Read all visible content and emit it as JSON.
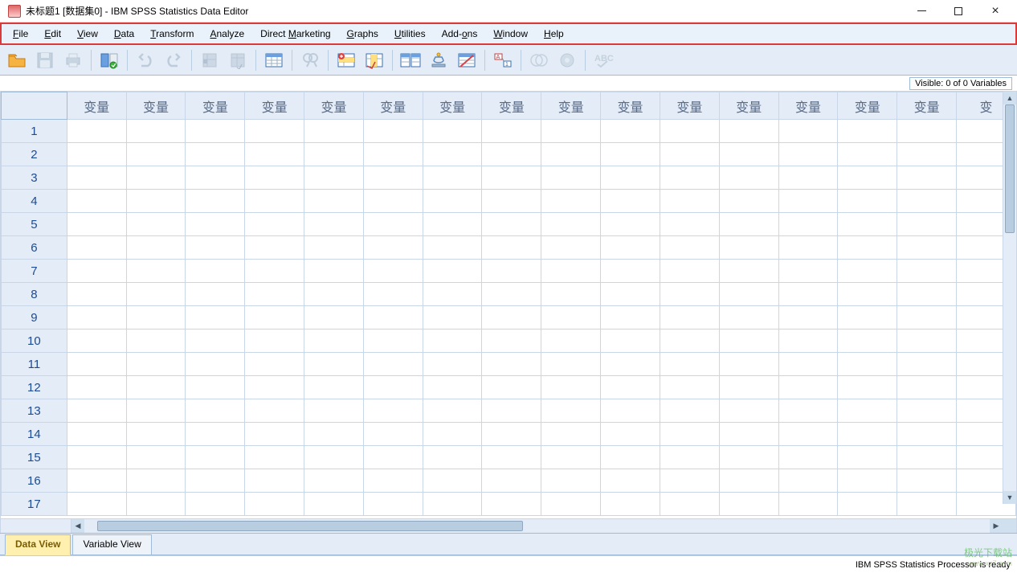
{
  "title": "未标题1 [数据集0] - IBM SPSS Statistics Data Editor",
  "menu": {
    "file": "File",
    "edit": "Edit",
    "view": "View",
    "data": "Data",
    "transform": "Transform",
    "analyze": "Analyze",
    "direct_marketing": "Direct Marketing",
    "graphs": "Graphs",
    "utilities": "Utilities",
    "addons": "Add-ons",
    "window": "Window",
    "help": "Help"
  },
  "toolbar": {
    "open": "open-icon",
    "save": "save-icon",
    "print": "print-icon",
    "recall": "recall-dialog-icon",
    "undo": "undo-icon",
    "redo": "redo-icon",
    "goto_case": "goto-case-icon",
    "goto_var": "goto-variable-icon",
    "variables": "variables-icon",
    "find": "find-icon",
    "insert_case": "insert-case-icon",
    "insert_var": "insert-variable-icon",
    "split": "split-file-icon",
    "weight": "weight-cases-icon",
    "select": "select-cases-icon",
    "value_labels": "value-labels-icon",
    "use_sets": "use-variable-sets-icon",
    "show_all": "show-all-variables-icon",
    "spell": "spell-check-icon"
  },
  "visible": "Visible: 0 of 0 Variables",
  "grid": {
    "col_label": "变量",
    "col_count": 16,
    "rows": [
      1,
      2,
      3,
      4,
      5,
      6,
      7,
      8,
      9,
      10,
      11,
      12,
      13,
      14,
      15,
      16,
      17
    ]
  },
  "tabs": {
    "data_view": "Data View",
    "variable_view": "Variable View"
  },
  "status": "IBM SPSS Statistics Processor is ready",
  "watermark": {
    "main": "极光下载站",
    "sub": "www.xz7.com"
  }
}
